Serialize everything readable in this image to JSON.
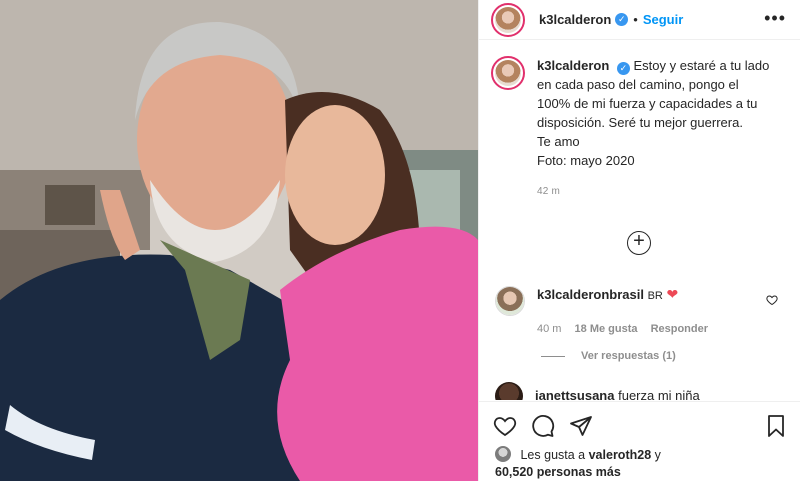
{
  "post": {
    "username": "k3lcalderon",
    "separator": "•",
    "follow_label": "Seguir",
    "more_label": "•••"
  },
  "caption": {
    "username": "k3lcalderon",
    "lines": [
      "Estoy y estaré a tu lado",
      "en cada paso del camino, pongo el",
      "100% de mi fuerza y capacidades a tu",
      "disposición. Seré tu mejor guerrera.",
      "Te amo",
      "Foto: mayo 2020"
    ],
    "time": "42 m"
  },
  "comments": [
    {
      "username": "k3lcalderonbrasil",
      "text": "BR",
      "emoji": "❤",
      "time": "40 m",
      "likes": "18 Me gusta",
      "reply": "Responder",
      "view_replies": "Ver respuestas (1)"
    },
    {
      "username": "janettsusana",
      "text": "fuerza mi niña"
    }
  ],
  "likes": {
    "prefix": "Les gusta a",
    "user": "valeroth28",
    "and": "y",
    "count": "60,520 personas más"
  },
  "colors": {
    "accent": "#0095f6",
    "verified": "#3897f0",
    "emoji_heart": "#ed4956"
  }
}
